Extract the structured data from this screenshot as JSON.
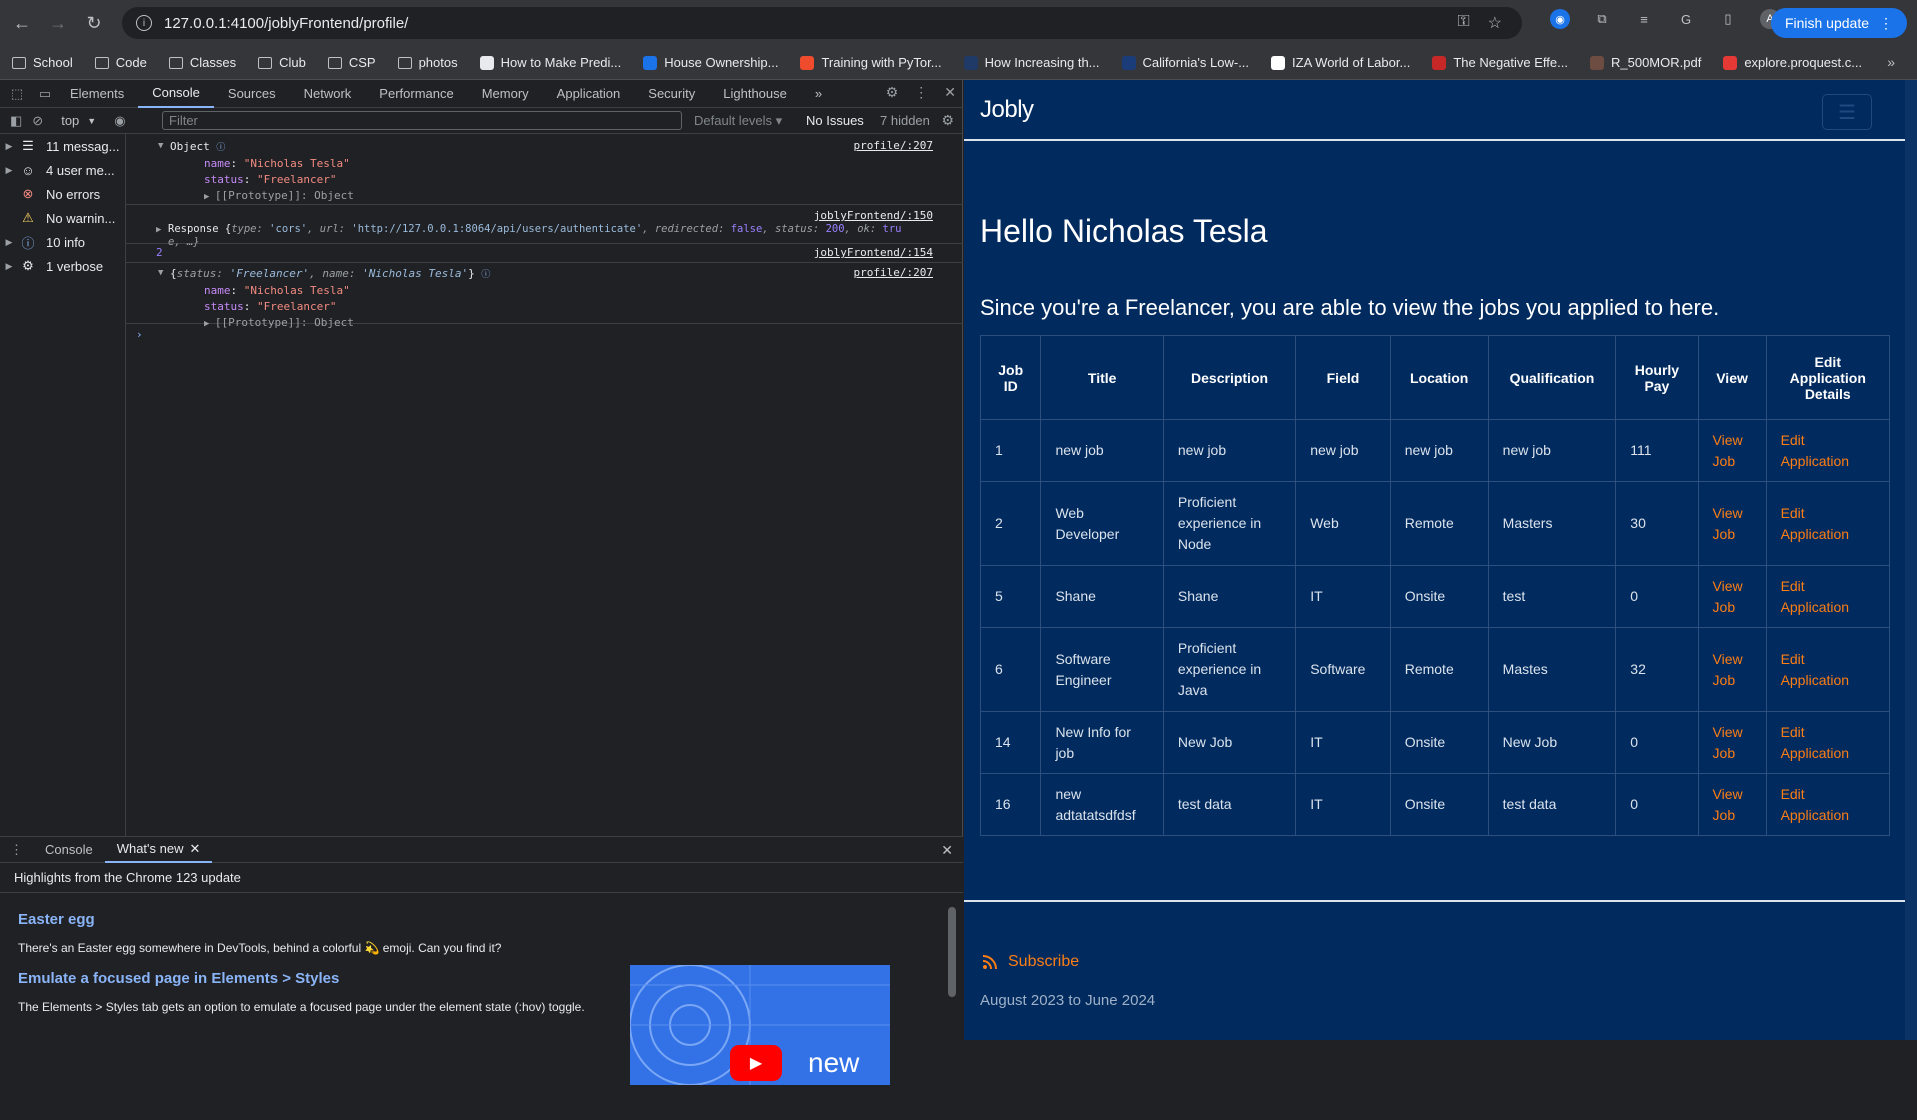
{
  "browser": {
    "url": "127.0.0.1:4100/joblyFrontend/profile/",
    "finish_update": "Finish update",
    "bookmarks": [
      {
        "label": "School",
        "type": "folder"
      },
      {
        "label": "Code",
        "type": "folder"
      },
      {
        "label": "Classes",
        "type": "folder"
      },
      {
        "label": "Club",
        "type": "folder"
      },
      {
        "label": "CSP",
        "type": "folder"
      },
      {
        "label": "photos",
        "type": "folder"
      },
      {
        "label": "How to Make Predi...",
        "type": "site",
        "color": "#e8eaed"
      },
      {
        "label": "House Ownership...",
        "type": "site",
        "color": "#1a73e8"
      },
      {
        "label": "Training with PyTor...",
        "type": "site",
        "color": "#ee4c2c"
      },
      {
        "label": "How Increasing th...",
        "type": "site",
        "color": "#1f3a66"
      },
      {
        "label": "California's Low-...",
        "type": "site",
        "color": "#1a3d7a"
      },
      {
        "label": "IZA World of Labor...",
        "type": "site",
        "color": "#ffffff"
      },
      {
        "label": "The Negative Effe...",
        "type": "site",
        "color": "#c62828"
      },
      {
        "label": "R_500MOR.pdf",
        "type": "site",
        "color": "#6d4c41"
      },
      {
        "label": "explore.proquest.c...",
        "type": "site",
        "color": "#e53935"
      }
    ]
  },
  "devtools": {
    "tabs": [
      "Elements",
      "Console",
      "Sources",
      "Network",
      "Performance",
      "Memory",
      "Application",
      "Security",
      "Lighthouse"
    ],
    "active_tab": "Console",
    "context": "top",
    "filter_placeholder": "Filter",
    "default_levels": "Default levels",
    "no_issues": "No Issues",
    "hidden_count": "7 hidden",
    "sidebar": [
      {
        "label": "11 messag...",
        "icon": "list-icon"
      },
      {
        "label": "4 user me...",
        "icon": "user-icon"
      },
      {
        "label": "No errors",
        "icon": "error-icon"
      },
      {
        "label": "No warnin...",
        "icon": "warning-icon"
      },
      {
        "label": "10 info",
        "icon": "info-icon"
      },
      {
        "label": "1 verbose",
        "icon": "verbose-icon"
      }
    ],
    "console": {
      "log1": {
        "label": "Object",
        "src": "profile/:207",
        "name_key": "name",
        "name_val": "\"Nicholas Tesla\"",
        "status_key": "status",
        "status_val": "\"Freelancer\"",
        "proto": "[[Prototype]]: Object"
      },
      "log2": {
        "src": "joblyFrontend/:150",
        "line1": "Response {",
        "type_key": "type",
        "type_val": "'cors'",
        "url_key": "url",
        "url_val": "'http://127.0.0.1:8064/api/users/authenticate'",
        "redir_key": "redirected",
        "redir_val": "false",
        "status_key": "status",
        "status_val": "200",
        "ok_key": "ok",
        "ok_val": "tru",
        "line2": "e, …}"
      },
      "log3": {
        "value": "2",
        "src": "joblyFrontend/:154"
      },
      "log4": {
        "summary_status_key": "status",
        "summary_status_val": "'Freelancer'",
        "summary_name_key": "name",
        "summary_name_val": "'Nicholas Tesla'",
        "src": "profile/:207",
        "name_key": "name",
        "name_val": "\"Nicholas Tesla\"",
        "status_key": "status",
        "status_val": "\"Freelancer\"",
        "proto": "[[Prototype]]: Object"
      }
    },
    "drawer": {
      "tabs": [
        "Console",
        "What's new"
      ],
      "active_tab": "What's new",
      "highlights": "Highlights from the Chrome 123 update",
      "sections": [
        {
          "heading": "Easter egg",
          "body": "There's an Easter egg somewhere in DevTools, behind a colorful 💫 emoji. Can you find it?"
        },
        {
          "heading": "Emulate a focused page in Elements > Styles",
          "body": "The Elements > Styles tab gets an option to emulate a focused page under the element state (:hov) toggle."
        }
      ],
      "video_text": "new"
    }
  },
  "page": {
    "brand": "Jobly",
    "hello": "Hello Nicholas Tesla",
    "since": "Since you're a Freelancer, you are able to view the jobs you applied to here.",
    "columns": [
      "Job ID",
      "Title",
      "Description",
      "Field",
      "Location",
      "Qualification",
      "Hourly Pay",
      "View",
      "Edit Application Details"
    ],
    "rows": [
      {
        "id": "1",
        "title": "new job",
        "description": "new job",
        "field": "new job",
        "location": "new job",
        "qualification": "new job",
        "pay": "111",
        "view": "View Job",
        "edit": "Edit Application"
      },
      {
        "id": "2",
        "title": "Web Developer",
        "description": "Proficient experience in Node",
        "field": "Web",
        "location": "Remote",
        "qualification": "Masters",
        "pay": "30",
        "view": "View Job",
        "edit": "Edit Application"
      },
      {
        "id": "5",
        "title": "Shane",
        "description": "Shane",
        "field": "IT",
        "location": "Onsite",
        "qualification": "test",
        "pay": "0",
        "view": "View Job",
        "edit": "Edit Application"
      },
      {
        "id": "6",
        "title": "Software Engineer",
        "description": "Proficient experience in Java",
        "field": "Software",
        "location": "Remote",
        "qualification": "Mastes",
        "pay": "32",
        "view": "View Job",
        "edit": "Edit Application"
      },
      {
        "id": "14",
        "title": "New Info for job",
        "description": "New Job",
        "field": "IT",
        "location": "Onsite",
        "qualification": "New Job",
        "pay": "0",
        "view": "View Job",
        "edit": "Edit Application"
      },
      {
        "id": "16",
        "title": "new adtatatsdfdsf",
        "description": "test data",
        "field": "IT",
        "location": "Onsite",
        "qualification": "test data",
        "pay": "0",
        "view": "View Job",
        "edit": "Edit Application"
      }
    ],
    "subscribe": "Subscribe",
    "dates": "August 2023 to June 2024"
  },
  "colors": {
    "page_bg": "#012a5e",
    "accent": "#fd7e14",
    "chrome_bg": "#35363a",
    "devtools_bg": "#202124"
  }
}
